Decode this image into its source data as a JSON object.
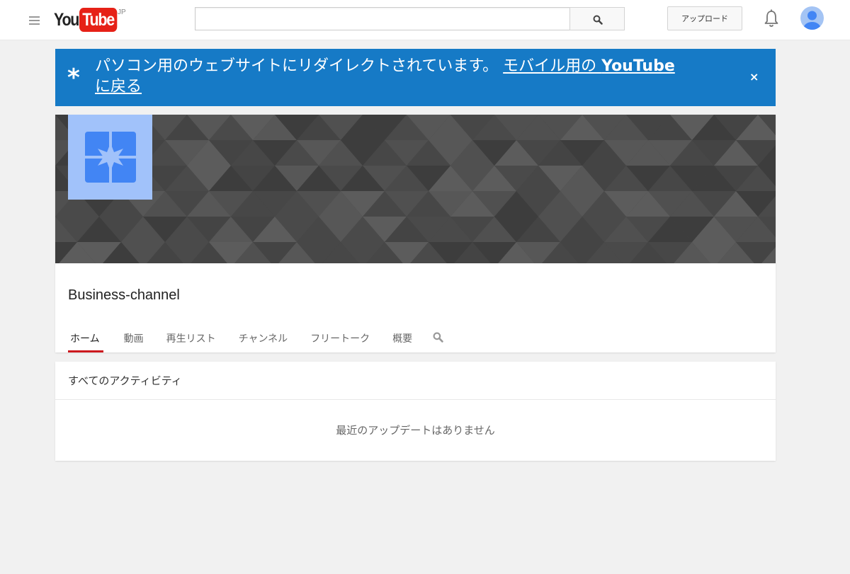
{
  "header": {
    "logo_you": "You",
    "logo_tube": "Tube",
    "region": "JP",
    "search_placeholder": "",
    "upload_label": "アップロード"
  },
  "notice": {
    "star": "*",
    "text": "パソコン用のウェブサイトにリダイレクトされています。",
    "link_prefix": "モバイル用の ",
    "link_brand": "YouTube",
    "link_suffix": "に戻る",
    "close": "×",
    "background_color": "#167ac6"
  },
  "channel": {
    "title": "Business-channel",
    "tabs": [
      {
        "label": "ホーム",
        "active": true
      },
      {
        "label": "動画",
        "active": false
      },
      {
        "label": "再生リスト",
        "active": false
      },
      {
        "label": "チャンネル",
        "active": false
      },
      {
        "label": "フリートーク",
        "active": false
      },
      {
        "label": "概要",
        "active": false
      }
    ],
    "tab_search_icon": "search-icon"
  },
  "activity": {
    "heading": "すべてのアクティビティ",
    "empty_message": "最近のアップデートはありません"
  },
  "icons": {
    "menu": "hamburger-menu-icon",
    "search": "search-icon",
    "bell": "bell-icon",
    "avatar": "user-avatar-icon"
  },
  "colors": {
    "brand_red": "#e62117",
    "tab_underline": "#cc181e",
    "channel_avatar_bg": "#a1c2fa",
    "channel_avatar_icon": "#4285f4"
  }
}
